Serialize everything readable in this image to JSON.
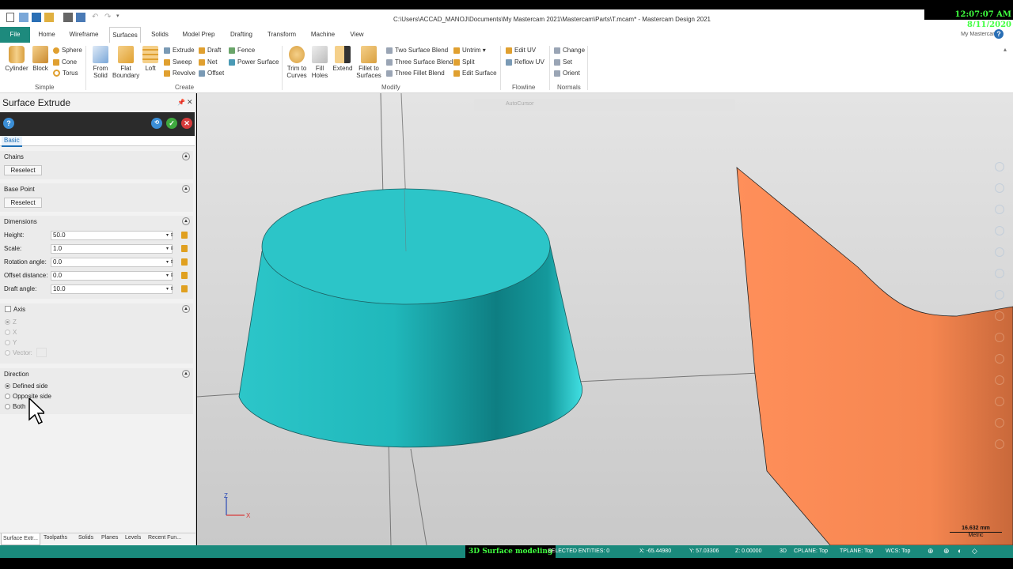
{
  "window": {
    "title": "C:\\Users\\ACCAD_MANOJ\\Documents\\My Mastercam 2021\\Mastercam\\Parts\\T.mcam* - Mastercam Design 2021",
    "clock": "12:07:07 AM 8/11/2020"
  },
  "ribbon_tabs": [
    "File",
    "Home",
    "Wireframe",
    "Surfaces",
    "Solids",
    "Model Prep",
    "Drafting",
    "Transform",
    "Machine",
    "View"
  ],
  "active_tab": "Surfaces",
  "my_mastercam": "My Mastercam",
  "ribbon": {
    "simple": {
      "label": "Simple",
      "cylinder": "Cylinder",
      "block": "Block",
      "sphere": "Sphere",
      "cone": "Cone",
      "torus": "Torus"
    },
    "create": {
      "label": "Create",
      "from_solid": [
        "From",
        "Solid"
      ],
      "flat_boundary": [
        "Flat",
        "Boundary"
      ],
      "loft": "Loft",
      "extrude": "Extrude",
      "sweep": "Sweep",
      "revolve": "Revolve",
      "draft": "Draft",
      "net": "Net",
      "offset": "Offset",
      "fence": "Fence",
      "power_surface": "Power Surface"
    },
    "modify": {
      "label": "Modify",
      "trim_to_curves": [
        "Trim to",
        "Curves"
      ],
      "fill_holes": [
        "Fill",
        "Holes"
      ],
      "extend": "Extend",
      "fillet_to_surfaces": [
        "Fillet to",
        "Surfaces"
      ],
      "two_surface_blend": "Two Surface Blend",
      "three_surface_blend": "Three Surface Blend",
      "three_fillet_blend": "Three Fillet Blend",
      "untrim": "Untrim",
      "split": "Split",
      "edit_surface": "Edit Surface"
    },
    "flowline": {
      "label": "Flowline",
      "edit_uv": "Edit UV",
      "reflow_uv": "Reflow UV"
    },
    "normals": {
      "label": "Normals",
      "change": "Change",
      "set": "Set",
      "orient": "Orient"
    }
  },
  "panel": {
    "title": "Surface Extrude",
    "tab": "Basic",
    "chains": {
      "title": "Chains",
      "button": "Reselect"
    },
    "base_point": {
      "title": "Base Point",
      "button": "Reselect"
    },
    "dimensions": {
      "title": "Dimensions",
      "fields": [
        {
          "label": "Height:",
          "value": "50.0"
        },
        {
          "label": "Scale:",
          "value": "1.0"
        },
        {
          "label": "Rotation angle:",
          "value": "0.0"
        },
        {
          "label": "Offset distance:",
          "value": "0.0"
        },
        {
          "label": "Draft angle:",
          "value": "10.0"
        }
      ]
    },
    "axis": {
      "title": "Axis",
      "options": [
        "Z",
        "X",
        "Y",
        "Vector:"
      ]
    },
    "direction": {
      "title": "Direction",
      "options": [
        "Defined side",
        "Opposite side",
        "Both"
      ],
      "selected": "Defined side"
    }
  },
  "bottom_tabs": [
    "Surface Extr...",
    "Toolpaths",
    "Solids",
    "Planes",
    "Levels",
    "Recent Fun..."
  ],
  "viewport": {
    "autocursor": "AutoCursor",
    "scale": "16.632 mm",
    "scale_unit": "Metric",
    "axis_z": "Z",
    "axis_x": "X",
    "colors": {
      "cone": "#26c3c6",
      "surface": "#ff8a55"
    }
  },
  "status": {
    "caption": "3D Surface modeling",
    "selected": "SELECTED ENTITIES: 0",
    "x": "X:   -65.44980",
    "y": "Y:   57.03306",
    "z": "Z:   0.00000",
    "mode": "3D",
    "cplane": "CPLANE: Top",
    "tplane": "TPLANE: Top",
    "wcs": "WCS: Top"
  }
}
